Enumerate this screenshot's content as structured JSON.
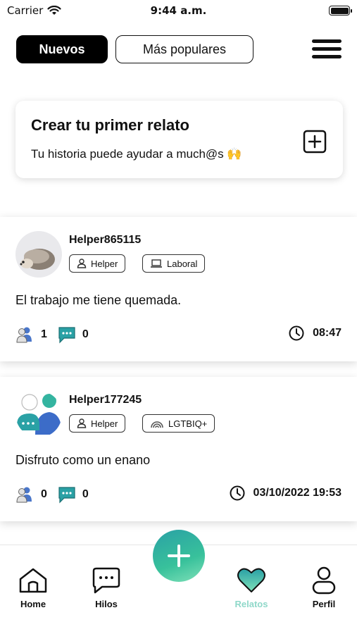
{
  "status_bar": {
    "carrier": "Carrier",
    "time": "9:44 a.m."
  },
  "segments": {
    "new": "Nuevos",
    "popular": "Más populares"
  },
  "create_card": {
    "title": "Crear tu primer relato",
    "subtitle": "Tu historia puede ayudar a much@s 🙌"
  },
  "posts": [
    {
      "username": "Helper865115",
      "tags": [
        "Helper",
        "Laboral"
      ],
      "text": "El trabajo me tiene quemada.",
      "followers": "1",
      "comments": "0",
      "time": "08:47"
    },
    {
      "username": "Helper177245",
      "tags": [
        "Helper",
        "LGTBIQ+"
      ],
      "text": "Disfruto como un enano",
      "followers": "0",
      "comments": "0",
      "time": "03/10/2022 19:53"
    }
  ],
  "tabs": [
    "Home",
    "Hilos",
    "Relatos",
    "Perfil"
  ],
  "colors": {
    "accent": "#2aa1a5",
    "active_tab": "#8fd8c9",
    "dark": "#111111"
  }
}
